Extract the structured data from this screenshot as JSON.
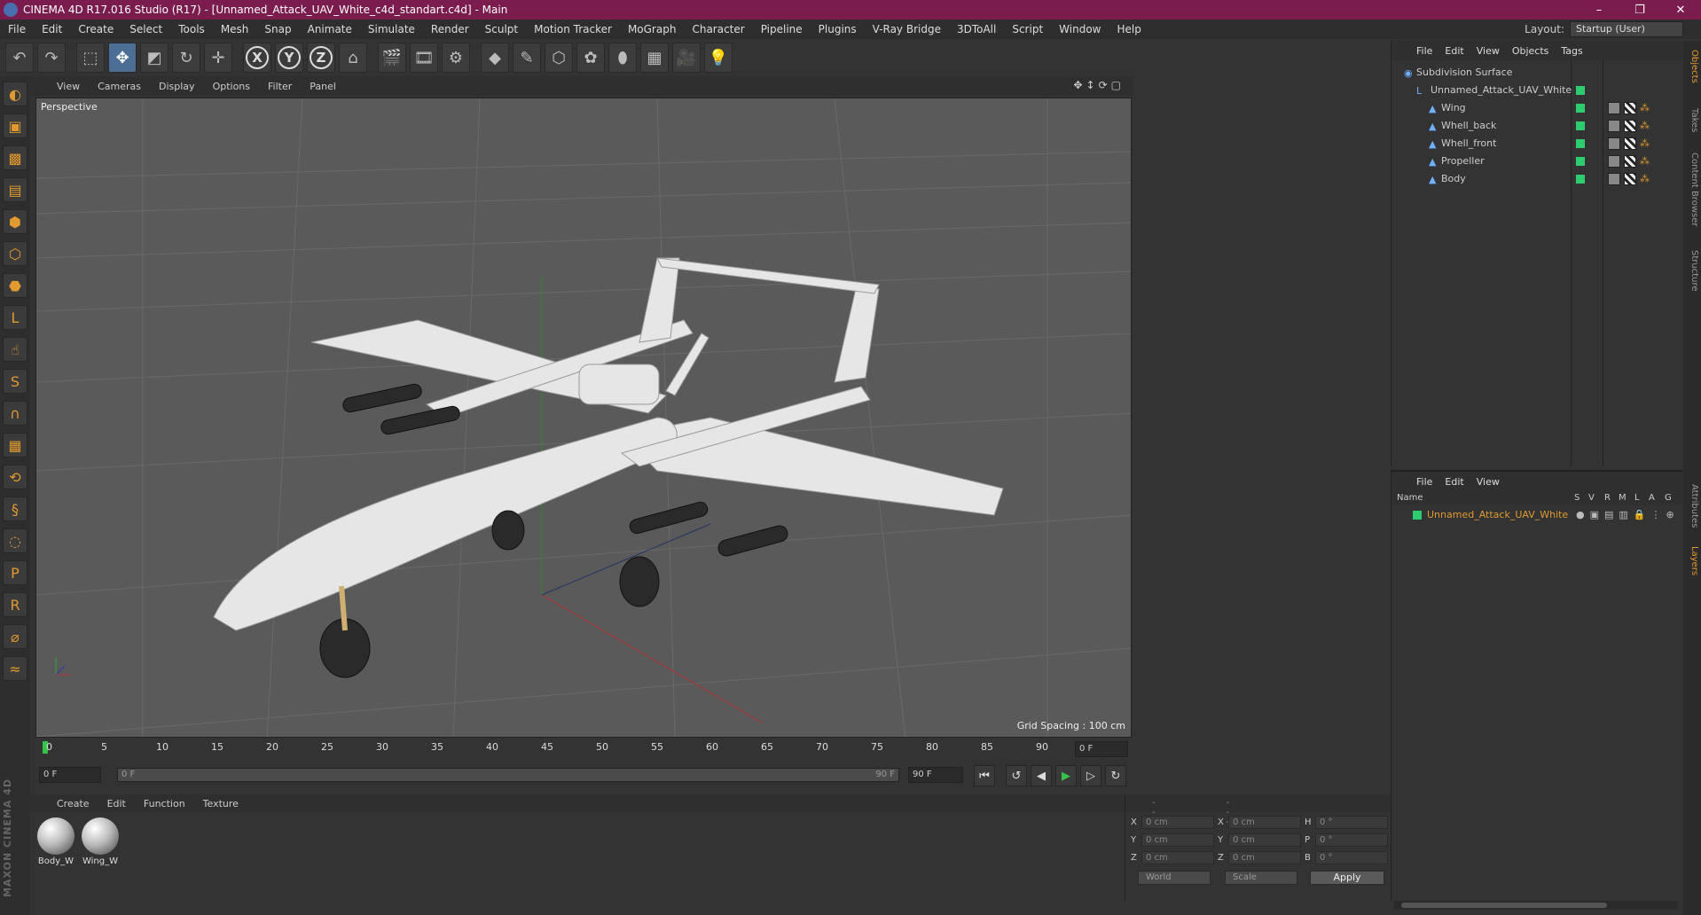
{
  "window": {
    "title": "CINEMA 4D R17.016 Studio (R17) - [Unnamed_Attack_UAV_White_c4d_standart.c4d] - Main",
    "controls": [
      "–",
      "❐",
      "✕"
    ]
  },
  "menu": {
    "items": [
      "File",
      "Edit",
      "Create",
      "Select",
      "Tools",
      "Mesh",
      "Snap",
      "Animate",
      "Simulate",
      "Render",
      "Sculpt",
      "Motion Tracker",
      "MoGraph",
      "Character",
      "Pipeline",
      "Plugins",
      "V-Ray Bridge",
      "3DToAll",
      "Script",
      "Window",
      "Help"
    ],
    "layout_label": "Layout:",
    "layout_value": "Startup (User)"
  },
  "toolbar": {
    "axis_x": "X",
    "axis_y": "Y",
    "axis_z": "Z"
  },
  "viewport": {
    "menu": [
      "View",
      "Cameras",
      "Display",
      "Options",
      "Filter",
      "Panel"
    ],
    "label": "Perspective",
    "grid_spacing": "Grid Spacing : 100 cm"
  },
  "timeline": {
    "ticks": [
      "0",
      "5",
      "10",
      "15",
      "20",
      "25",
      "30",
      "35",
      "40",
      "45",
      "50",
      "55",
      "60",
      "65",
      "70",
      "75",
      "80",
      "85",
      "90"
    ],
    "current_frame": "0 F"
  },
  "playback": {
    "start_field": "0 F",
    "slider_start": "0 F",
    "slider_end": "90 F",
    "end_field": "90 F"
  },
  "materials": {
    "menu": [
      "Create",
      "Edit",
      "Function",
      "Texture"
    ],
    "items": [
      {
        "name": "Body_W"
      },
      {
        "name": "Wing_W"
      }
    ]
  },
  "coordinates": {
    "header": [
      "--",
      "--",
      "--"
    ],
    "rows": [
      {
        "a": "X",
        "av": "0 cm",
        "b": "X",
        "bv": "0 cm",
        "c": "H",
        "cv": "0 °"
      },
      {
        "a": "Y",
        "av": "0 cm",
        "b": "Y",
        "bv": "0 cm",
        "c": "P",
        "cv": "0 °"
      },
      {
        "a": "Z",
        "av": "0 cm",
        "b": "Z",
        "bv": "0 cm",
        "c": "B",
        "cv": "0 °"
      }
    ],
    "world": "World",
    "scale": "Scale",
    "apply": "Apply"
  },
  "objects": {
    "menu": [
      "File",
      "Edit",
      "View",
      "Objects",
      "Tags"
    ],
    "tree": [
      {
        "name": "Subdivision Surface"
      },
      {
        "name": "Unnamed_Attack_UAV_White"
      },
      {
        "name": "Wing"
      },
      {
        "name": "Whell_back"
      },
      {
        "name": "Whell_front"
      },
      {
        "name": "Propeller"
      },
      {
        "name": "Body"
      }
    ]
  },
  "layers": {
    "menu": [
      "File",
      "Edit",
      "View"
    ],
    "columns": [
      "Name",
      "S",
      "V",
      "R",
      "M",
      "L",
      "A",
      "G"
    ],
    "rows": [
      {
        "name": "Unnamed_Attack_UAV_White",
        "color": "#2ecc71"
      }
    ]
  },
  "right_tabs": [
    "Objects",
    "Takes",
    "Content Browser",
    "Structure",
    "Attributes",
    "Layers"
  ],
  "brand": "MAXON CINEMA 4D",
  "colors": {
    "titlebar": "#7a1c4d",
    "accent": "#e09a30",
    "layer_green": "#2ecc71"
  }
}
